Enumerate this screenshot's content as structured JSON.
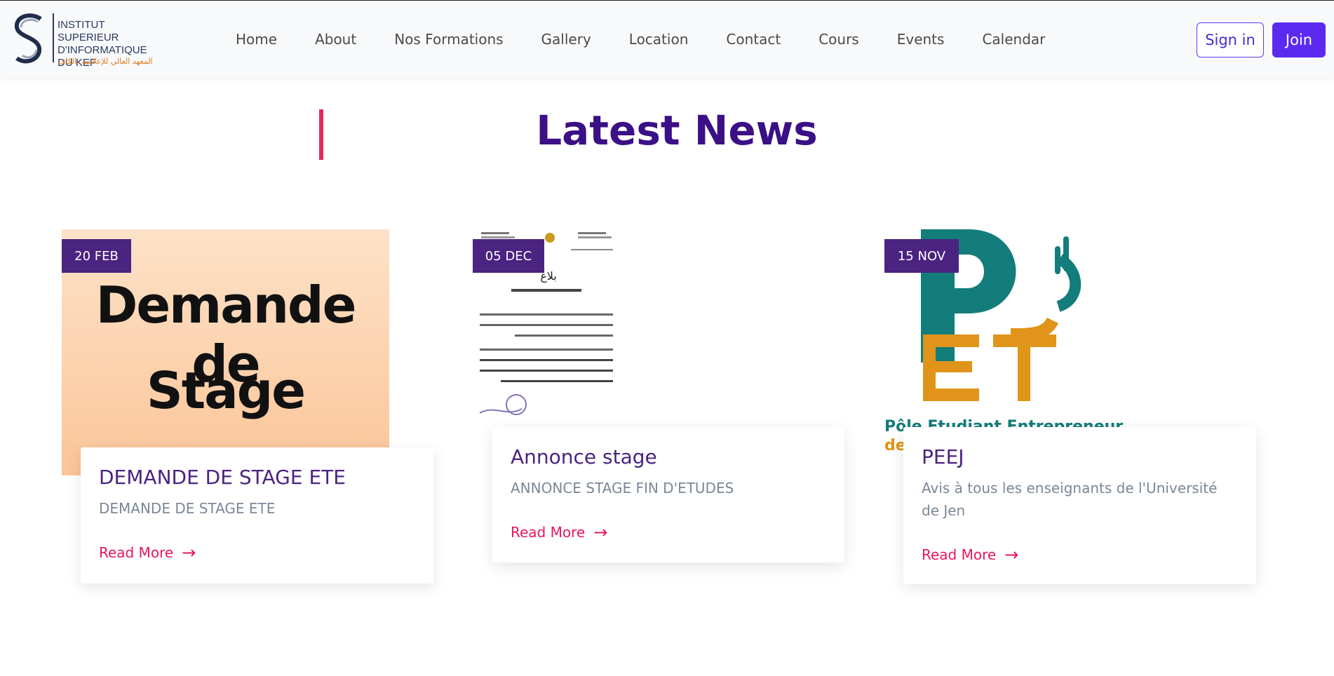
{
  "header": {
    "logo_lines": [
      "INSTITUT SUPERIEUR",
      "D'INFORMATIQUE",
      "DU KEF"
    ],
    "logo_arabic": "المعهد العالي للإعلامية بالكاف",
    "nav": [
      "Home",
      "About",
      "Nos Formations",
      "Gallery",
      "Location",
      "Contact",
      "Cours",
      "Events",
      "Calendar"
    ],
    "signin": "Sign in",
    "join": "Join"
  },
  "section": {
    "title": "Latest News"
  },
  "cards": [
    {
      "date": "20 FEB",
      "title": "DEMANDE DE STAGE ETE",
      "text": "DEMANDE DE STAGE ETE",
      "more": "Read More",
      "thumb_line1": "Demande de",
      "thumb_line2": "Stage"
    },
    {
      "date": "05 DEC",
      "title": "Annonce stage",
      "text": "ANNONCE STAGE FIN D'ETUDES",
      "more": "Read More",
      "thumb_title": "بلاغ"
    },
    {
      "date": "15 NOV",
      "title": "PEEJ",
      "text": "Avis à tous les enseignants de l'Université de Jen",
      "more": "Read More",
      "thumb_caption": "Pôle Etudiant Entrepreneur",
      "thumb_caption2": "de"
    }
  ],
  "colors": {
    "accent": "#5b2af0",
    "purple": "#4b2381",
    "pink": "#e8165d",
    "title": "#3b0f86"
  }
}
